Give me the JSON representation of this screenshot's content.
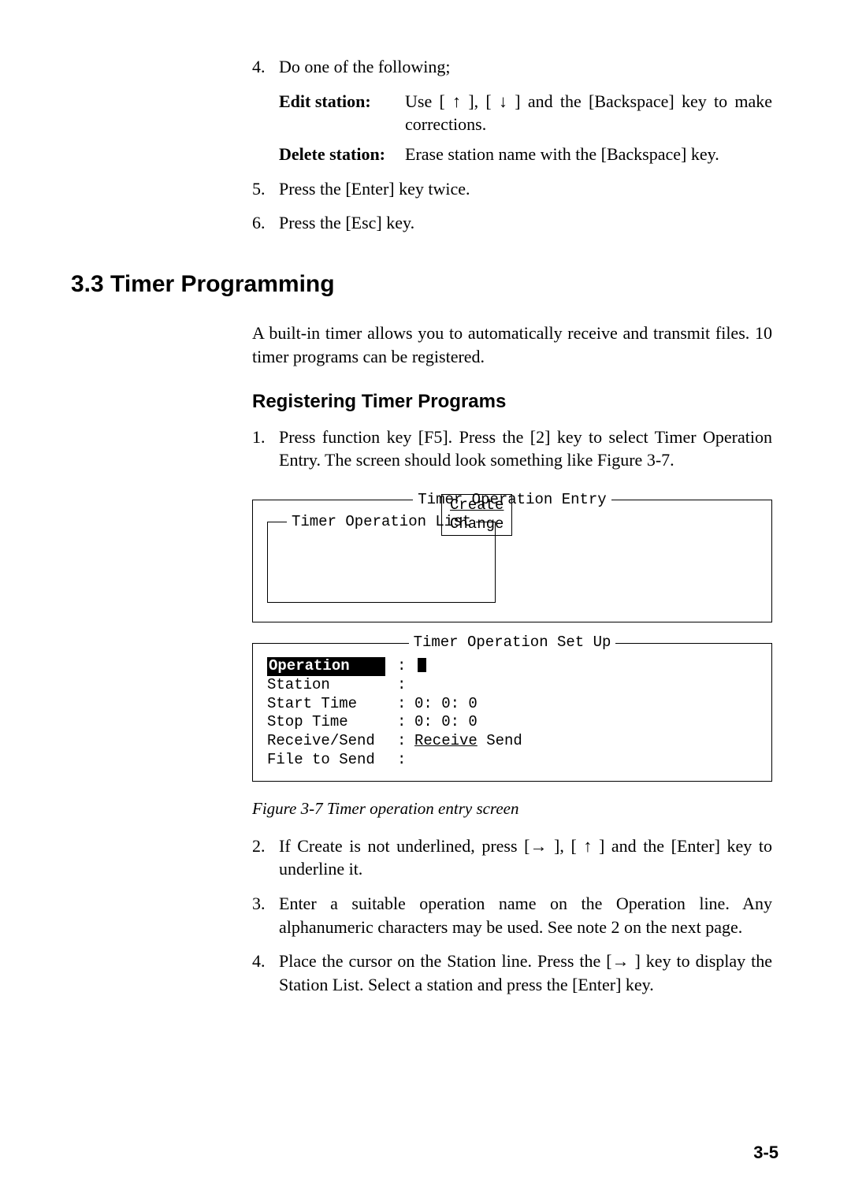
{
  "steps_top": {
    "s4": {
      "num": "4.",
      "text": "Do one of the following;"
    },
    "edit": {
      "term": "Edit station:",
      "desc": "Use [ ↑ ], [ ↓ ] and the [Backspace] key to make corrections."
    },
    "delete": {
      "term": "Delete station:",
      "desc": "Erase station name with the [Backspace] key."
    },
    "s5": {
      "num": "5.",
      "text": "Press the [Enter] key twice."
    },
    "s6": {
      "num": "6.",
      "text": "Press the [Esc] key."
    }
  },
  "section_title": "3.3 Timer Programming",
  "section_intro": "A built-in timer allows you to automatically receive and transmit files. 10 timer programs can be registered.",
  "subhead": "Registering Timer Programs",
  "step1": {
    "num": "1.",
    "text": "Press function key [F5]. Press the [2] key to select Timer Operation Entry. The screen should look something like Figure 3-7."
  },
  "figure": {
    "top_legend": "Timer Operation Entry",
    "inner_legend": "Timer Operation List",
    "choice_create": "Create",
    "choice_change": "Change",
    "bottom_legend": "Timer Operation Set Up",
    "rows": {
      "operation": {
        "k": "Operation",
        "v": ""
      },
      "station": {
        "k": "Station",
        "v": ""
      },
      "start": {
        "k": "Start Time",
        "v": " 0: 0: 0"
      },
      "stop": {
        "k": "Stop Time",
        "v": " 0: 0: 0"
      },
      "rs": {
        "k": "Receive/Send",
        "v_u": "Receive",
        "v_r": " Send"
      },
      "file": {
        "k": "File to Send",
        "v": ""
      }
    },
    "caption": "Figure 3-7 Timer operation entry screen"
  },
  "steps_after": {
    "s2": {
      "num": "2.",
      "text": "If Create is not underlined, press [→ ], [ ↑ ] and the [Enter] key to underline it."
    },
    "s3": {
      "num": "3.",
      "text": "Enter a suitable operation name on the Operation line. Any alphanumeric characters may be used. See note 2 on the next page."
    },
    "s4": {
      "num": "4.",
      "text": "Place the cursor on the Station line. Press the [→ ] key to display the Station List. Select a station and press the [Enter] key."
    }
  },
  "page_number": "3-5"
}
